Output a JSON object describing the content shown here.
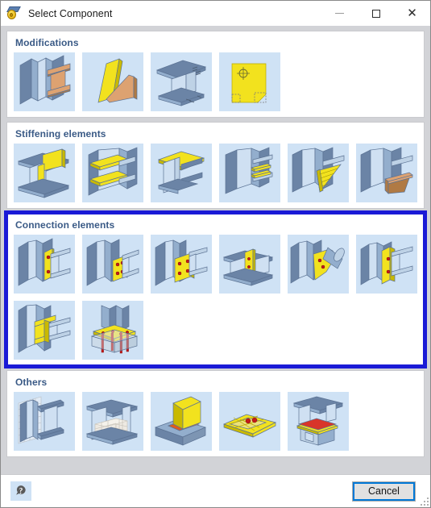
{
  "window": {
    "title": "Select Component",
    "icon": "component-icon",
    "controls": {
      "minimize": "minimize-icon",
      "maximize": "maximize-icon",
      "close": "close-icon"
    }
  },
  "sections": [
    {
      "id": "modifications",
      "title": "Modifications",
      "highlighted": false,
      "tiles": [
        {
          "name": "beam-cut-to-column",
          "icon": "modification-beam-column-brown"
        },
        {
          "name": "plate-skewed-cut",
          "icon": "modification-skewed-plates"
        },
        {
          "name": "beam-notch-coping",
          "icon": "modification-beam-coping"
        },
        {
          "name": "plate-hole-contour",
          "icon": "modification-plate-hole"
        }
      ]
    },
    {
      "id": "stiffening-elements",
      "title": "Stiffening elements",
      "highlighted": false,
      "tiles": [
        {
          "name": "web-stiffener-vertical",
          "icon": "stiffener-vertical-plate"
        },
        {
          "name": "horizontal-stiffeners-pair",
          "icon": "stiffener-horizontal-pair"
        },
        {
          "name": "flange-cap-plate",
          "icon": "stiffener-cap-plate"
        },
        {
          "name": "multi-stiffener-ribs",
          "icon": "stiffener-ribs-stack"
        },
        {
          "name": "haunch-stiffener-triangular",
          "icon": "stiffener-haunch-yellow"
        },
        {
          "name": "haunch-stiffener-brown",
          "icon": "stiffener-haunch-brown"
        }
      ]
    },
    {
      "id": "connection-elements",
      "title": "Connection elements",
      "highlighted": true,
      "tiles": [
        {
          "name": "end-plate-connection-2-bolts",
          "icon": "connection-end-plate-2bolt"
        },
        {
          "name": "fin-plate-connection-4-bolts",
          "icon": "connection-fin-plate-4bolt"
        },
        {
          "name": "end-plate-connection-8-bolts",
          "icon": "connection-end-plate-8bolt"
        },
        {
          "name": "double-beam-web-plate",
          "icon": "connection-double-beam-plate"
        },
        {
          "name": "tube-gusset-connection",
          "icon": "connection-tube-gusset"
        },
        {
          "name": "angle-cleat-connection",
          "icon": "connection-angle-cleat"
        },
        {
          "name": "haunch-moment-connection",
          "icon": "connection-haunch-moment"
        },
        {
          "name": "column-base-plate-anchors",
          "icon": "connection-base-plate-anchors"
        }
      ]
    },
    {
      "id": "others",
      "title": "Others",
      "highlighted": false,
      "tiles": [
        {
          "name": "wall-embedded-beam",
          "icon": "other-wall-mesh-beam"
        },
        {
          "name": "concrete-block-beam",
          "icon": "other-concrete-block"
        },
        {
          "name": "welded-seam-detail",
          "icon": "other-weld-seam"
        },
        {
          "name": "base-plate-top-view",
          "icon": "other-plate-top-view"
        },
        {
          "name": "bracket-support-beam",
          "icon": "other-bracket-support"
        }
      ]
    }
  ],
  "footer": {
    "help_icon": "help-question-icon",
    "cancel_label": "Cancel",
    "resize_grip": "resize-grip-icon"
  },
  "colors": {
    "section_title": "#3a5a86",
    "highlight_border": "#1a1ad6",
    "tile_background": "#cfe2f5",
    "focus_outline": "#0078d7",
    "steel_blue": "#8fa9c8",
    "accent_yellow": "#f2e21e",
    "accent_brown": "#d9a06a",
    "bolt_red": "#c41a1a"
  }
}
